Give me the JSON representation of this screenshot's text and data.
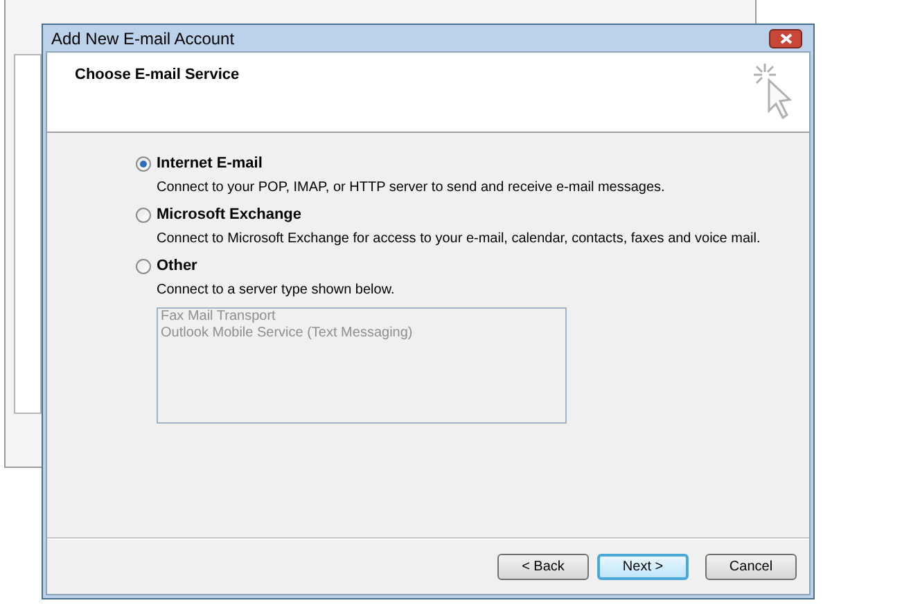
{
  "window": {
    "title": "Add New E-mail Account"
  },
  "header": {
    "title": "Choose E-mail Service"
  },
  "options": [
    {
      "label": "Internet E-mail",
      "description": "Connect to your POP, IMAP, or HTTP server to send and receive e-mail messages.",
      "selected": true
    },
    {
      "label": "Microsoft Exchange",
      "description": "Connect to Microsoft Exchange for access to your e-mail, calendar, contacts, faxes and voice mail.",
      "selected": false
    },
    {
      "label": "Other",
      "description": "Connect to a server type shown below.",
      "selected": false
    }
  ],
  "server_list": {
    "disabled": true,
    "items": [
      "Fax Mail Transport",
      "Outlook Mobile Service (Text Messaging)"
    ]
  },
  "buttons": [
    {
      "label": "< Back",
      "default": false
    },
    {
      "label": "Next >",
      "default": true
    },
    {
      "label": "Cancel",
      "default": false
    }
  ]
}
